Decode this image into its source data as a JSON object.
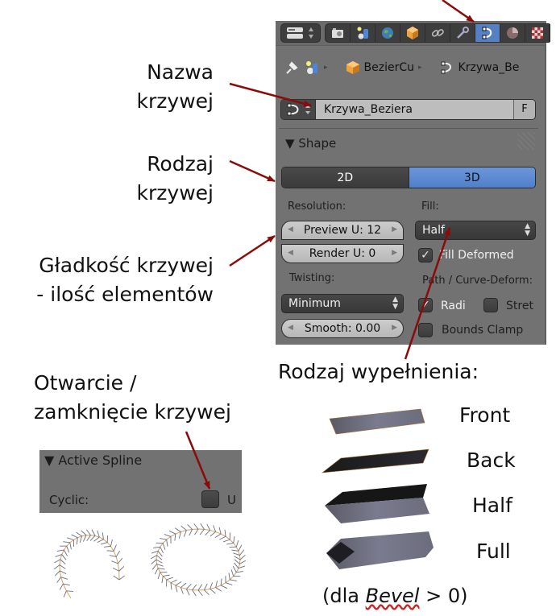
{
  "annotations": {
    "curve_name": [
      "Nazwa",
      "krzywej"
    ],
    "curve_type": [
      "Rodzaj",
      "krzywej"
    ],
    "smoothness": [
      "Gładkość krzywej",
      "- ilość elementów"
    ],
    "cyclic": [
      "Otwarcie /",
      "zamknięcie krzywej"
    ],
    "fill_type": "Rodzaj wypełnienia:",
    "bevel_note_prefix": "(dla ",
    "bevel_note_word": "Bevel",
    "bevel_note_suffix": " > 0)"
  },
  "colors": {
    "arrow": "#8b0a0a",
    "panel_bg": "#727272",
    "accent_blue": "#5680c2"
  },
  "toolbar": {
    "tabs": [
      {
        "icon": "render-camera-icon"
      },
      {
        "icon": "render-layers-icon"
      },
      {
        "icon": "world-icon"
      },
      {
        "icon": "object-icon"
      },
      {
        "icon": "constraints-link-icon"
      },
      {
        "icon": "modifiers-wrench-icon"
      },
      {
        "icon": "curve-data-icon",
        "active": true
      },
      {
        "icon": "material-icon"
      },
      {
        "icon": "texture-icon"
      }
    ]
  },
  "breadcrumb": {
    "object": "BezierCu",
    "data": "Krzywa_Be"
  },
  "datablock": {
    "name": "Krzywa_Beziera",
    "fake_user": "F"
  },
  "shape": {
    "header": "Shape",
    "dimensions": {
      "options": [
        "2D",
        "3D"
      ],
      "selected": "3D"
    },
    "resolution_label": "Resolution:",
    "preview_u": "Preview U: 12",
    "render_u": "Render U: 0",
    "fill_label": "Fill:",
    "fill_value": "Half",
    "fill_deformed": {
      "label": "Fill Deformed",
      "checked": true
    },
    "twisting_label": "Twisting:",
    "twisting_value": "Minimum",
    "smooth": "Smooth: 0.00",
    "path_label": "Path / Curve-Deform:",
    "radius": {
      "label": "Radi",
      "checked": true
    },
    "stretch": {
      "label": "Stret",
      "checked": false
    },
    "bounds_clamp": {
      "label": "Bounds Clamp",
      "checked": false
    }
  },
  "active_spline": {
    "header": "Active Spline",
    "cyclic_label": "Cyclic:",
    "cyclic_u": "U",
    "cyclic_checked": false
  },
  "fill_examples": [
    {
      "label": "Front"
    },
    {
      "label": "Back"
    },
    {
      "label": "Half"
    },
    {
      "label": "Full"
    }
  ]
}
